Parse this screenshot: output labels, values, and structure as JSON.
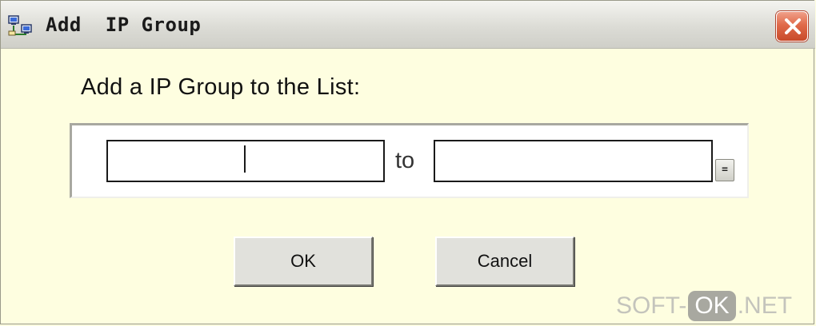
{
  "window": {
    "title": "Add  IP Group",
    "app_icon": "network-computers-icon",
    "close_icon": "close-icon"
  },
  "dialog": {
    "prompt": "Add a IP Group to the List:",
    "ip_from": {
      "value": "",
      "placeholder": ""
    },
    "separator": "to",
    "ip_to": {
      "value": "",
      "placeholder": ""
    },
    "mini_button_label": "="
  },
  "buttons": {
    "ok": "OK",
    "cancel": "Cancel"
  },
  "watermark": {
    "left": "SOFT-",
    "middle": "OK",
    "right": ".NET"
  },
  "colors": {
    "dialog_background": "#fefee0",
    "close_button": "#e06a4a"
  }
}
